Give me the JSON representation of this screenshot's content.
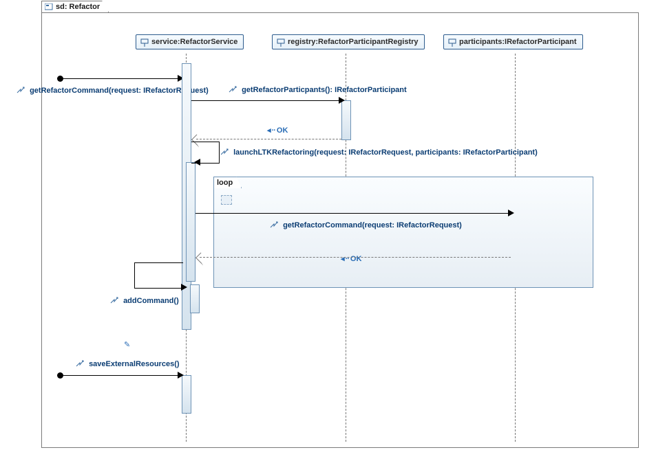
{
  "frame": {
    "label": "sd: Refactor"
  },
  "lifelines": {
    "service": "service:RefactorService",
    "registry": "registry:RefactorParticipantRegistry",
    "participants": "participants:IRefactorParticipant"
  },
  "messages": {
    "m1": "getRefactorCommand(request: IRefactorRequest)",
    "m2": "getRefactorParticpants(): IRefactorParticipant",
    "m2_ret": "OK",
    "m3": "launchLTKRefactoring(request: IRefactorRequest, participants: IRefactorParticipant)",
    "loop_label": "loop",
    "m4": "getRefactorCommand(request: IRefactorRequest)",
    "m4_ret": "OK",
    "m5": "addCommand()",
    "m6": "saveExternalResources()"
  }
}
